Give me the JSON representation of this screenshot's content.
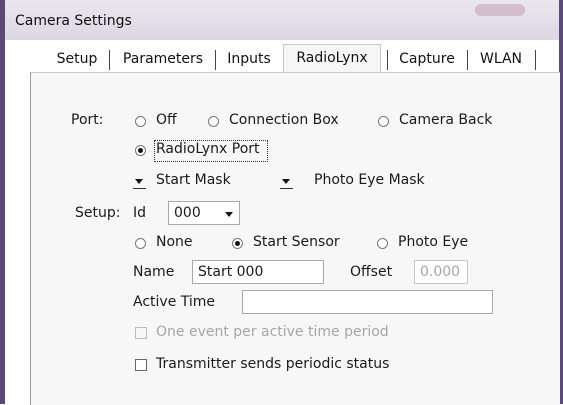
{
  "window": {
    "title": "Camera Settings"
  },
  "tabs": [
    {
      "label": "Setup"
    },
    {
      "label": "Parameters"
    },
    {
      "label": "Inputs"
    },
    {
      "label": "RadioLynx",
      "active": true
    },
    {
      "label": "Capture"
    },
    {
      "label": "WLAN"
    }
  ],
  "port": {
    "label": "Port:",
    "options": [
      {
        "label": "Off",
        "selected": false
      },
      {
        "label": "Connection Box",
        "selected": false
      },
      {
        "label": "Camera Back",
        "selected": false
      },
      {
        "label": "RadioLynx Port",
        "selected": true
      }
    ]
  },
  "masks": {
    "start_mask": "Start Mask",
    "photo_eye_mask": "Photo Eye Mask"
  },
  "setup": {
    "label": "Setup:",
    "id_label": "Id",
    "id_value": "000",
    "sensor_options": [
      {
        "label": "None",
        "selected": false
      },
      {
        "label": "Start Sensor",
        "selected": true
      },
      {
        "label": "Photo Eye",
        "selected": false
      }
    ],
    "name_label": "Name",
    "name_value": "Start 000",
    "offset_label": "Offset",
    "offset_value": "0.000",
    "active_time_label": "Active Time",
    "active_time_value": "",
    "one_event_label": "One event per active time period",
    "one_event_checked": false,
    "one_event_enabled": false,
    "periodic_status_label": "Transmitter sends periodic status",
    "periodic_status_checked": false
  }
}
